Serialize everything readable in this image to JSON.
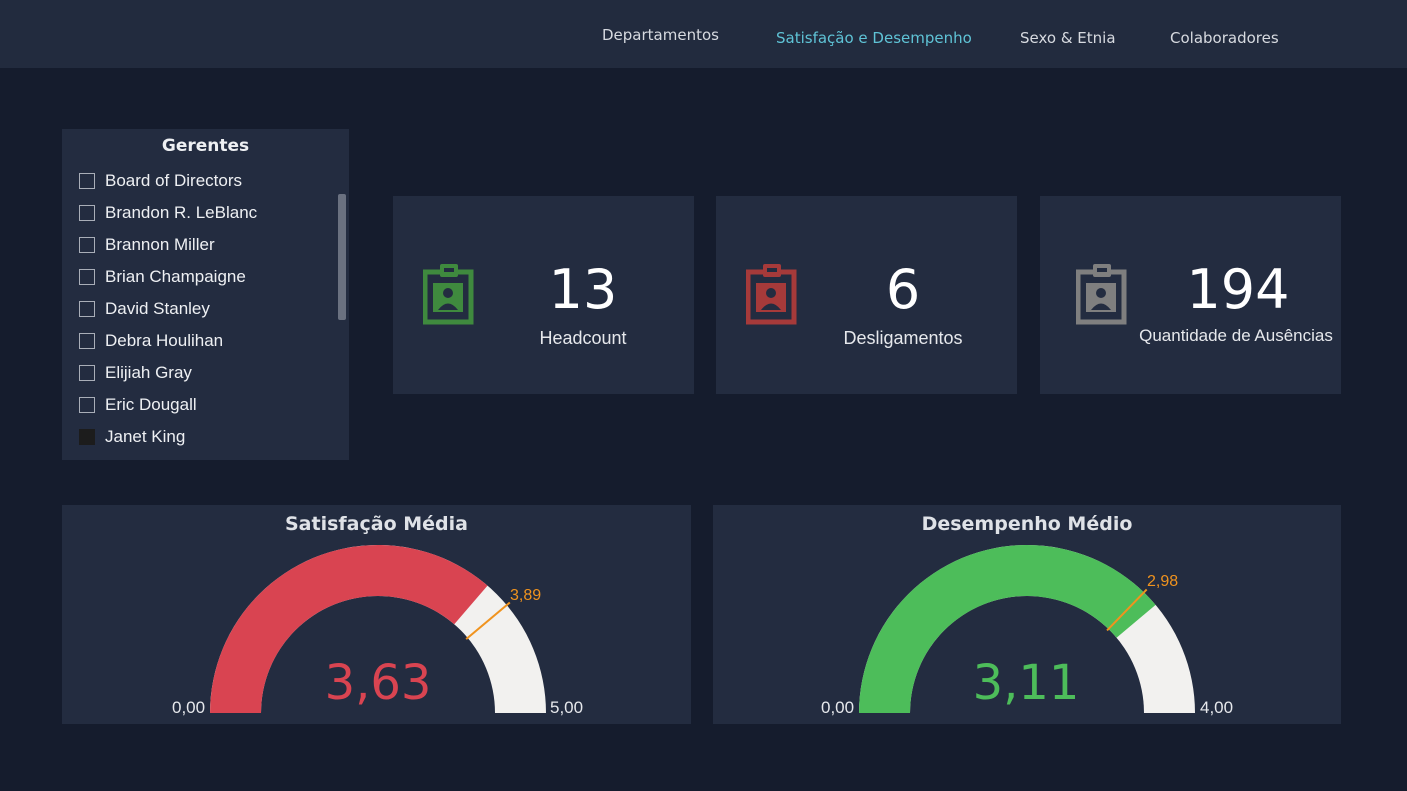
{
  "nav": {
    "items": [
      {
        "label": "Departamentos",
        "active": false
      },
      {
        "label": "Satisfação e Desempenho",
        "active": true
      },
      {
        "label": "Sexo & Etnia",
        "active": false
      },
      {
        "label": "Colaboradores",
        "active": false
      }
    ]
  },
  "slicer": {
    "title": "Gerentes",
    "items": [
      {
        "label": "Board of Directors",
        "checked": false
      },
      {
        "label": "Brandon R. LeBlanc",
        "checked": false
      },
      {
        "label": "Brannon Miller",
        "checked": false
      },
      {
        "label": "Brian Champaigne",
        "checked": false
      },
      {
        "label": "David Stanley",
        "checked": false
      },
      {
        "label": "Debra Houlihan",
        "checked": false
      },
      {
        "label": "Elijiah Gray",
        "checked": false
      },
      {
        "label": "Eric Dougall",
        "checked": false
      },
      {
        "label": "Janet King",
        "checked": true
      }
    ]
  },
  "kpis": [
    {
      "value": "13",
      "label": "Headcount",
      "icon": "badge-icon",
      "icon_color": "#3f8a3e"
    },
    {
      "value": "6",
      "label": "Desligamentos",
      "icon": "badge-icon",
      "icon_color": "#a63a3a"
    },
    {
      "value": "194",
      "label": "Quantidade de Ausências",
      "icon": "badge-icon",
      "icon_color": "#7f7f7f"
    }
  ],
  "gauges": [
    {
      "title": "Satisfação Média",
      "value": 3.63,
      "value_label": "3,63",
      "min": 0,
      "min_label": "0,00",
      "max": 5,
      "max_label": "5,00",
      "target": 3.89,
      "target_label": "3,89",
      "color": "#d94451"
    },
    {
      "title": "Desempenho Médio",
      "value": 3.11,
      "value_label": "3,11",
      "min": 0,
      "min_label": "0,00",
      "max": 4,
      "max_label": "4,00",
      "target": 2.98,
      "target_label": "2,98",
      "color": "#4dbd5a"
    }
  ],
  "colors": {
    "background": "#151c2d",
    "panel": "#232c40",
    "topbar": "#222b3e",
    "nav_active": "#5fc3d6",
    "target": "#f0931e",
    "gauge_track": "#f2f1ef"
  }
}
